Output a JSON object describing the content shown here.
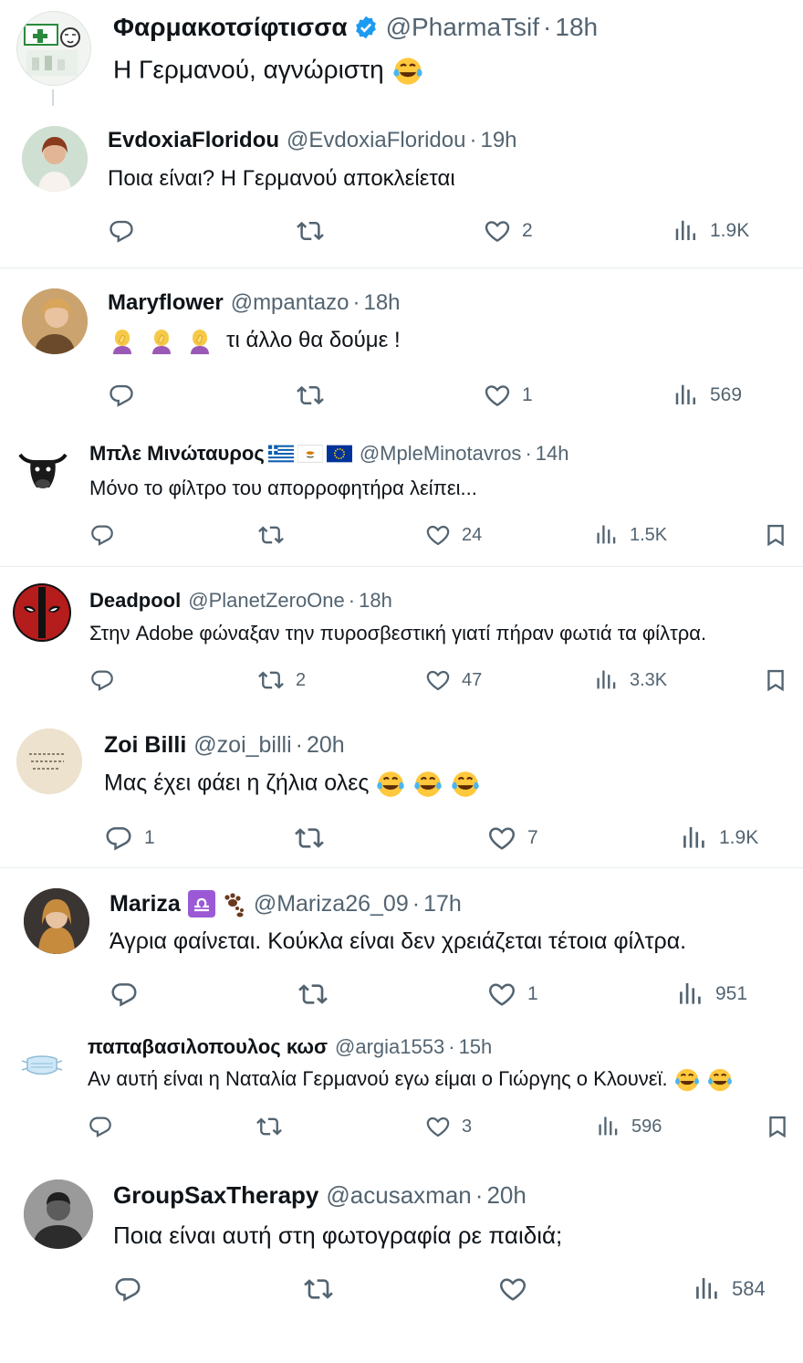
{
  "root": {
    "name": "Φαρμακοτσίφτισσα",
    "handle": "@PharmaTsif",
    "time": "18h",
    "text": "Η Γερμανού, αγνώριστη"
  },
  "replies": [
    {
      "name": "EvdoxiaFloridou",
      "handle": "@EvdoxiaFloridou",
      "time": "19h",
      "text": "Ποια είναι? Η Γερμανού αποκλείεται",
      "reply": "",
      "repost": "",
      "like": "2",
      "views": "1.9K"
    },
    {
      "name": "Maryflower",
      "handle": "@mpantazo",
      "time": "18h",
      "text": "τι άλλο θα δούμε !",
      "reply": "",
      "repost": "",
      "like": "1",
      "views": "569"
    },
    {
      "name": "Μπλε Μινώταυρος",
      "handle": "@MpleMinotavros",
      "time": "14h",
      "text": "Μόνο το φίλτρο του απορροφητήρα λείπει...",
      "reply": "",
      "repost": "",
      "like": "24",
      "views": "1.5K"
    },
    {
      "name": "Deadpool",
      "handle": "@PlanetZeroOne",
      "time": "18h",
      "text": "Στην Adobe φώναξαν την πυροσβεστική γιατί πήραν φωτιά τα φίλτρα.",
      "reply": "",
      "repost": "2",
      "like": "47",
      "views": "3.3K"
    },
    {
      "name": "Zoi Billi",
      "handle": "@zoi_billi",
      "time": "20h",
      "text": "Μας έχει φάει η ζήλια ολες",
      "reply": "1",
      "repost": "",
      "like": "7",
      "views": "1.9K"
    },
    {
      "name": "Mariza",
      "handle": "@Mariza26_09",
      "time": "17h",
      "text": "Άγρια φαίνεται. Κούκλα είναι δεν χρειάζεται τέτοια φίλτρα.",
      "reply": "",
      "repost": "",
      "like": "1",
      "views": "951"
    },
    {
      "name": "παπαβασιλοπουλος κωσ",
      "handle": "@argia1553",
      "time": "15h",
      "text": "Αν αυτή είναι η Ναταλία Γερμανού εγω είμαι ο Γιώργης ο Κλουνεϊ.",
      "reply": "",
      "repost": "",
      "like": "3",
      "views": "596"
    },
    {
      "name": "GroupSaxTherapy",
      "handle": "@acusaxman",
      "time": "20h",
      "text": "Ποια είναι αυτή στη φωτογραφία ρε παιδιά;",
      "reply": "",
      "repost": "",
      "like": "",
      "views": "584"
    }
  ],
  "separator": "·",
  "colors": {
    "muted": "#536471",
    "verified": "#1d9bf0",
    "text": "#0f1419"
  }
}
